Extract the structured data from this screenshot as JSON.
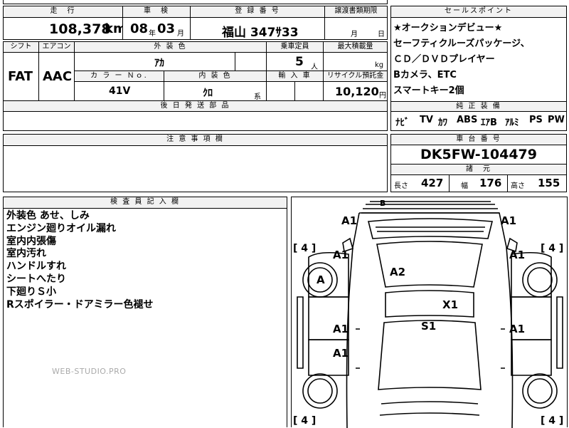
{
  "top": {
    "headers": {
      "mileage": "走　行",
      "inspection": "車　検",
      "registration": "登 録 番 号",
      "transfer_deadline": "譲渡書類期限"
    },
    "mileage_value": "108,378",
    "mileage_unit": "km",
    "inspection_year": "08",
    "year_char": "年",
    "inspection_month": "03",
    "month_char": "月",
    "registration_number": "福山 347ｻ33",
    "transfer_month": "月",
    "transfer_day": "日"
  },
  "mid": {
    "headers": {
      "shift": "シフト",
      "aircon": "エアコン",
      "exterior_color": "外 装 色",
      "capacity": "乗車定員",
      "max_load": "最大積載量",
      "color_no": "カ ラ ー Ｎｏ.",
      "interior_color": "内 装 色",
      "import": "輸 入 車",
      "recycle": "リサイクル預託金",
      "after_parts": "後 日 発 送 部 品"
    },
    "shift_value": "FAT",
    "aircon_value": "AAC",
    "exterior_color_value": "ｱｶ",
    "capacity_value": "5",
    "capacity_unit": "人",
    "load_unit": "kg",
    "color_no_value": "41V",
    "interior_color_value": "ｸﾛ",
    "interior_suffix": "系",
    "recycle_value": "10,120",
    "recycle_unit": "円"
  },
  "sales_point": {
    "header": "セールスポイント",
    "lines": [
      "★オークションデビュー★",
      "セーフティクルーズパッケージ、",
      "ＣＤ／ＤＶＤプレイヤー",
      "Bカメラ、ETC",
      "スマートキー2個"
    ],
    "equipment_header": "純 正 装 備",
    "equipment": [
      "ﾅﾋﾞ",
      "TV",
      "ｶﾜ",
      "ABS",
      "ｴｱB",
      "ｱﾙﾐ",
      "PS",
      "PW"
    ]
  },
  "caution": {
    "header": "注 意 事 項 欄"
  },
  "chassis": {
    "header": "車 台 番 号",
    "number": "DK5FW-104479",
    "specs_header": "諸　元",
    "length_label": "長さ",
    "length": "427",
    "width_label": "幅",
    "width": "176",
    "height_label": "高さ",
    "height": "155"
  },
  "inspector": {
    "header": "検 査 員 記 入 欄",
    "notes": [
      "外装色 あせ、しみ",
      "エンジン廻りオイル漏れ",
      "室内内張傷",
      "室内汚れ",
      "ハンドルすれ",
      "シートへたり",
      "下廻りＳ小",
      "Rスポイラー・ドアミラー色褪せ"
    ],
    "watermark": "WEB-STUDIO.PRO"
  },
  "diagram": {
    "marks": [
      "A1",
      "A1",
      "A1",
      "A1",
      "A",
      "A2",
      "X1",
      "A1",
      "S1",
      "A1",
      "A1",
      "B"
    ],
    "tire_brackets": [
      "[ 4 ]",
      "[ 4 ]",
      "[ 4 ]",
      "[ 4 ]"
    ]
  }
}
